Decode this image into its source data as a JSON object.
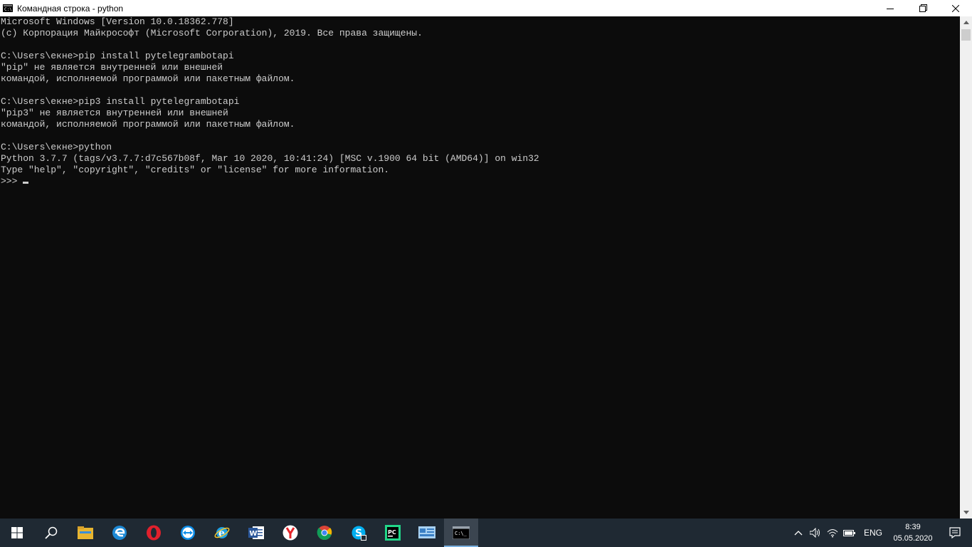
{
  "window": {
    "title": "Командная строка - python",
    "controls": [
      "minimize",
      "maximize",
      "close"
    ]
  },
  "console": {
    "lines": [
      "Microsoft Windows [Version 10.0.18362.778]",
      "(с) Корпорация Майкрософт (Microsoft Corporation), 2019. Все права защищены.",
      "",
      "C:\\Users\\екне>pip install pytelegrambotapi",
      "\"pip\" не является внутренней или внешней",
      "командой, исполняемой программой или пакетным файлом.",
      "",
      "C:\\Users\\екне>pip3 install pytelegrambotapi",
      "\"pip3\" не является внутренней или внешней",
      "командой, исполняемой программой или пакетным файлом.",
      "",
      "C:\\Users\\екне>python",
      "Python 3.7.7 (tags/v3.7.7:d7c567b08f, Mar 10 2020, 10:41:24) [MSC v.1900 64 bit (AMD64)] on win32",
      "Type \"help\", \"copyright\", \"credits\" or \"license\" for more information."
    ],
    "prompt": ">>>"
  },
  "taskbar": {
    "apps": [
      {
        "icon": "file-explorer-icon"
      },
      {
        "icon": "edge-icon"
      },
      {
        "icon": "opera-icon"
      },
      {
        "icon": "teamviewer-icon"
      },
      {
        "icon": "internet-explorer-icon"
      },
      {
        "icon": "word-icon"
      },
      {
        "icon": "yandex-browser-icon"
      },
      {
        "icon": "chrome-icon"
      },
      {
        "icon": "skype-icon"
      },
      {
        "icon": "pycharm-icon"
      },
      {
        "icon": "control-panel-icon"
      },
      {
        "icon": "command-prompt-icon",
        "active": true
      }
    ],
    "language": "ENG",
    "time": "8:39",
    "date": "05.05.2020"
  },
  "colors": {
    "console_bg": "#0c0c0c",
    "console_text": "#cccccc",
    "taskbar_bg": "#1f2933",
    "titlebar_bg": "#ffffff"
  }
}
